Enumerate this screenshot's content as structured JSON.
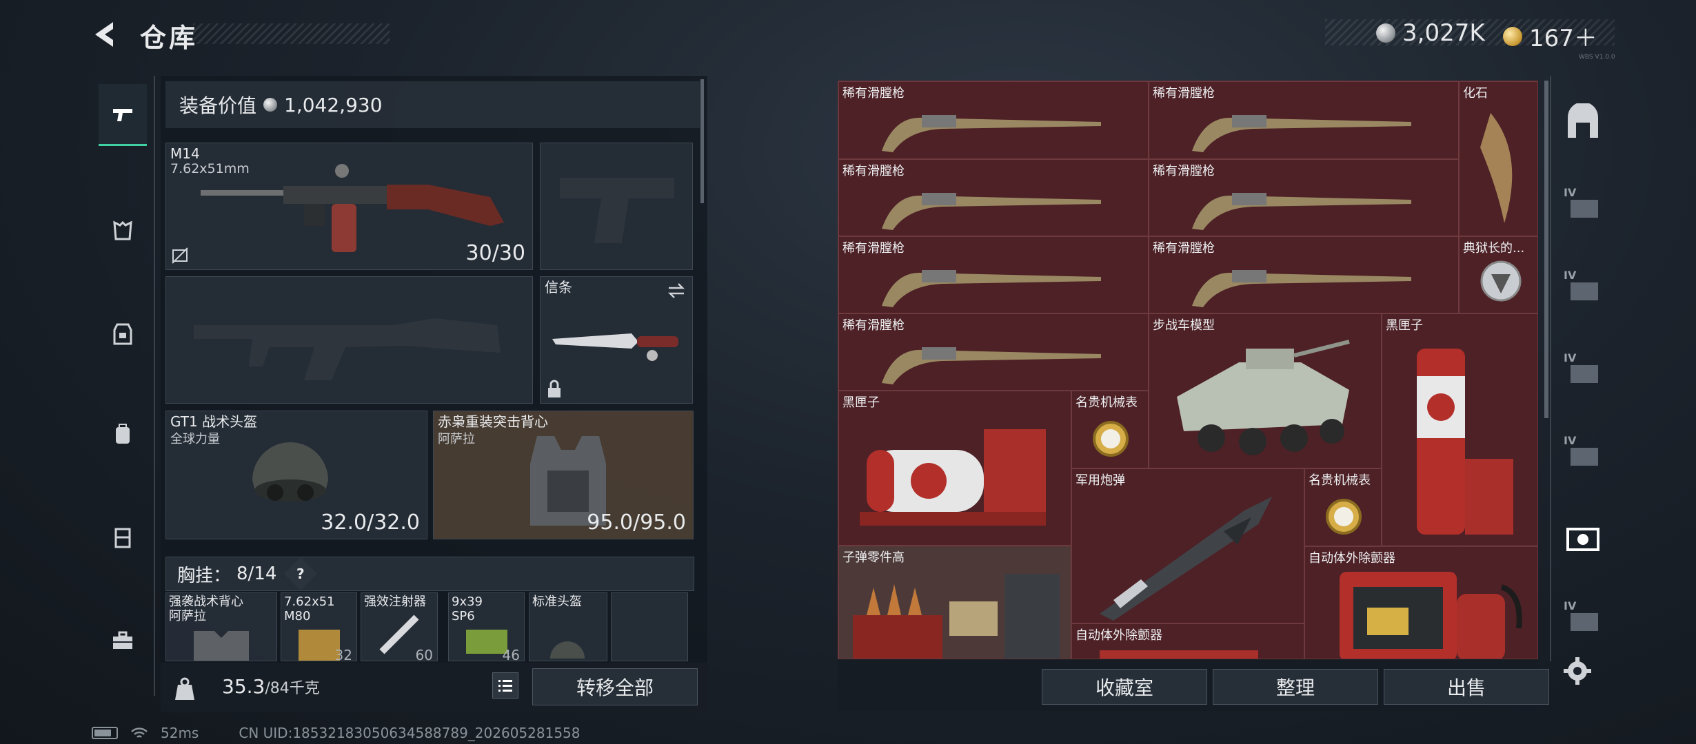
{
  "header": {
    "title": "仓库",
    "currency_silver": "3,027K",
    "currency_gold": "167＋",
    "version_tag": "WBS V1.0.0"
  },
  "equipment": {
    "value_label": "装备价值",
    "value": "1,042,930",
    "primary_weapon": {
      "name": "M14",
      "caliber": "7.62x51mm",
      "ammo": "30/30"
    },
    "melee": {
      "name": "信条"
    },
    "helmet": {
      "name": "GT1 战术头盔",
      "faction": "全球力量",
      "durability": "32.0/32.0"
    },
    "armor": {
      "name": "赤枭重装突击背心",
      "faction": "阿萨拉",
      "durability": "95.0/95.0"
    },
    "chest_rig": {
      "label": "胸挂：",
      "count": "8/14",
      "help": "?"
    },
    "chest_items": [
      {
        "name": "强袭战术背心",
        "sub": "阿萨拉",
        "count": ""
      },
      {
        "name": "7.62x51",
        "sub": "M80",
        "count": "32"
      },
      {
        "name": "强效注射器",
        "sub": "",
        "count": "60"
      },
      {
        "name": "9x39",
        "sub": "SP6",
        "count": "46"
      },
      {
        "name": "标准头盔",
        "sub": "",
        "count": ""
      },
      {
        "name": "",
        "sub": "",
        "count": ""
      }
    ],
    "weight": "35.3",
    "weight_max": "/84千克",
    "transfer_all": "转移全部"
  },
  "storage": {
    "items": [
      {
        "label": "稀有滑膛枪",
        "icon": "musket"
      },
      {
        "label": "稀有滑膛枪",
        "icon": "musket"
      },
      {
        "label": "化石",
        "icon": "fossil-claw"
      },
      {
        "label": "稀有滑膛枪",
        "icon": "musket"
      },
      {
        "label": "稀有滑膛枪",
        "icon": "musket"
      },
      {
        "label": "稀有滑膛枪",
        "icon": "musket"
      },
      {
        "label": "稀有滑膛枪",
        "icon": "musket"
      },
      {
        "label": "典狱长的...",
        "icon": "warden-medal"
      },
      {
        "label": "稀有滑膛枪",
        "icon": "musket"
      },
      {
        "label": "步战车模型",
        "icon": "ifv-model"
      },
      {
        "label": "黑匣子",
        "icon": "black-box"
      },
      {
        "label": "黑匣子",
        "icon": "black-box"
      },
      {
        "label": "名贵机械表",
        "icon": "gold-watch"
      },
      {
        "label": "军用炮弹",
        "icon": "missile"
      },
      {
        "label": "名贵机械表",
        "icon": "gold-watch"
      },
      {
        "label": "子弹零件高",
        "icon": "ammo-parts"
      },
      {
        "label": "自动体外除颤器",
        "icon": "defibrillator"
      },
      {
        "label": "自动体外除颤器",
        "icon": "defibrillator"
      }
    ],
    "buttons": {
      "collection": "收藏室",
      "sort": "整理",
      "sell": "出售"
    }
  },
  "status": {
    "ping": "52ms",
    "uid": "CN UID:18532183050634588789_202605281558"
  },
  "colors": {
    "accent": "#3fd1a4",
    "grid_bg": "#4a1e23",
    "panel_bg": "#262e38"
  }
}
